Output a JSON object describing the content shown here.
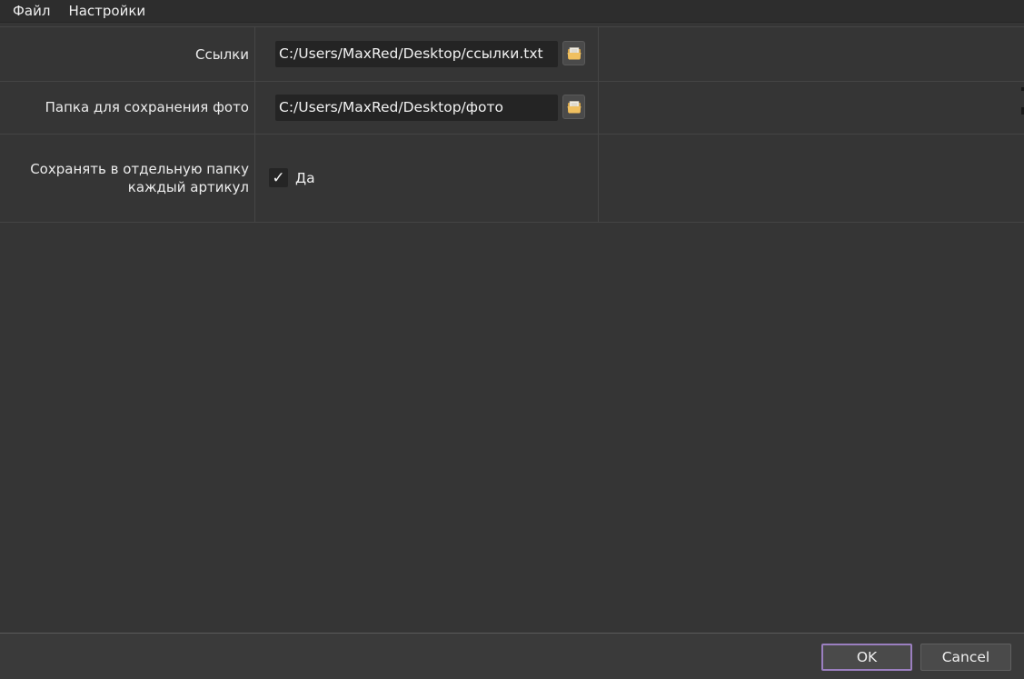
{
  "menubar": {
    "items": [
      {
        "label": "Файл"
      },
      {
        "label": "Настройки"
      }
    ]
  },
  "form": {
    "links": {
      "label": "Ссылки",
      "value": "C:/Users/MaxRed/Desktop/ссылки.txt",
      "browse_icon": "open-folder-icon"
    },
    "photo_folder": {
      "label": "Папка для сохранения фото",
      "value": "C:/Users/MaxRed/Desktop/фото",
      "browse_icon": "open-folder-icon"
    },
    "separate_folder": {
      "label_line1": "Сохранять в отдельную папку",
      "label_line2": "каждый артикул",
      "checked": true,
      "check_mark": "✓",
      "checkbox_label": "Да"
    }
  },
  "buttons": {
    "ok_label": "OK",
    "cancel_label": "Cancel"
  },
  "colors": {
    "background": "#353535",
    "input_background": "#242424",
    "ok_border": "#9b7fc0"
  }
}
